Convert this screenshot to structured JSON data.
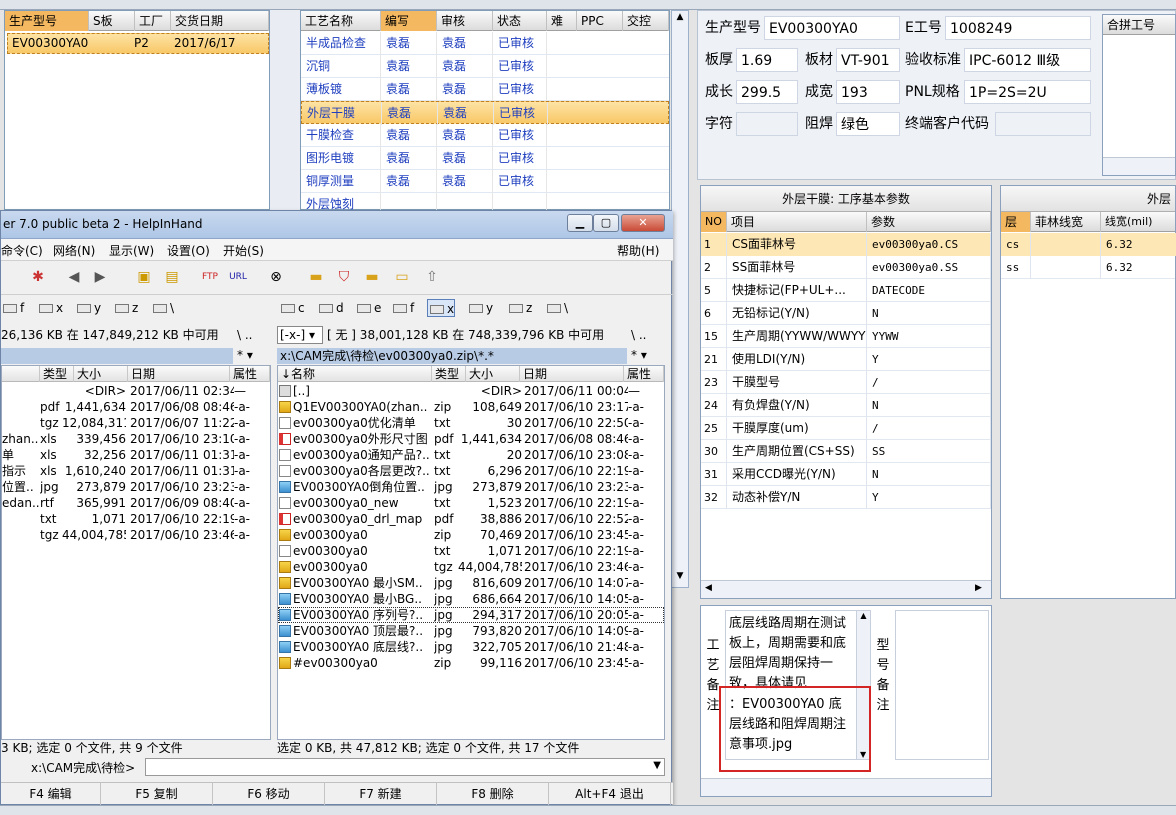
{
  "order_pane": {
    "headers": [
      "生产型号",
      "S板",
      "工厂",
      "交货日期"
    ],
    "rows": [
      {
        "model": "EV00300YA0",
        "s": "",
        "factory": "P2",
        "date": "2017/6/17"
      }
    ]
  },
  "process_pane": {
    "headers": [
      "工艺名称",
      "编写",
      "审核",
      "状态",
      "难",
      "PPC",
      "交控"
    ],
    "rows": [
      {
        "name": "半成品检查",
        "writer": "袁磊",
        "reviewer": "袁磊",
        "status": "已审核"
      },
      {
        "name": "沉铜",
        "writer": "袁磊",
        "reviewer": "袁磊",
        "status": "已审核"
      },
      {
        "name": "薄板镀",
        "writer": "袁磊",
        "reviewer": "袁磊",
        "status": "已审核"
      },
      {
        "name": "外层干膜",
        "writer": "袁磊",
        "reviewer": "袁磊",
        "status": "已审核"
      },
      {
        "name": "干膜检查",
        "writer": "袁磊",
        "reviewer": "袁磊",
        "status": "已审核"
      },
      {
        "name": "图形电镀",
        "writer": "袁磊",
        "reviewer": "袁磊",
        "status": "已审核"
      },
      {
        "name": "铜厚测量",
        "writer": "袁磊",
        "reviewer": "袁磊",
        "status": "已审核"
      },
      {
        "name": "外层蚀刻",
        "writer": "",
        "reviewer": "",
        "status": ""
      }
    ]
  },
  "info": {
    "model_label": "生产型号",
    "model_value": "EV00300YA0",
    "eno_label": "E工号",
    "eno_value": "1008249",
    "thick_label": "板厚",
    "thick_value": "1.69",
    "mat_label": "板材",
    "mat_value": "VT-901",
    "std_label": "验收标准",
    "std_value": "IPC-6012 Ⅲ级",
    "len_label": "成长",
    "len_value": "299.5",
    "wid_label": "成宽",
    "wid_value": "193",
    "pnl_label": "PNL规格",
    "pnl_value": "1P=2S=2U",
    "char_label": "字符",
    "char_value": "",
    "mask_label": "阻焊",
    "mask_value": "绿色",
    "cust_label": "终端客户代码",
    "cust_value": "",
    "pin_label": "合拼工号"
  },
  "params": {
    "title": "外层干膜: 工序基本参数",
    "headers": [
      "NO",
      "项目",
      "参数"
    ],
    "rows": [
      {
        "no": "1",
        "item": "CS面菲林号",
        "value": "ev00300ya0.CS"
      },
      {
        "no": "2",
        "item": "SS面菲林号",
        "value": "ev00300ya0.SS"
      },
      {
        "no": "5",
        "item": "快捷标记(FP+UL+...",
        "value": "DATECODE"
      },
      {
        "no": "6",
        "item": "无铅标记(Y/N)",
        "value": "N"
      },
      {
        "no": "15",
        "item": "生产周期(YYWW/WWYY)",
        "value": "YYWW"
      },
      {
        "no": "21",
        "item": "使用LDI(Y/N)",
        "value": "Y"
      },
      {
        "no": "23",
        "item": "干膜型号",
        "value": "/"
      },
      {
        "no": "24",
        "item": "有负焊盘(Y/N)",
        "value": "N"
      },
      {
        "no": "25",
        "item": "干膜厚度(um)",
        "value": "/"
      },
      {
        "no": "30",
        "item": "生产周期位置(CS+SS)",
        "value": "SS"
      },
      {
        "no": "31",
        "item": "采用CCD曝光(Y/N)",
        "value": "N"
      },
      {
        "no": "32",
        "item": "动态补偿Y/N",
        "value": "Y"
      }
    ]
  },
  "lines": {
    "title": "外层",
    "headers": [
      "层",
      "菲林线宽",
      "线宽(mil)"
    ],
    "rows": [
      {
        "layer": "cs",
        "film": "",
        "width": "6.32"
      },
      {
        "layer": "ss",
        "film": "",
        "width": "6.32"
      }
    ]
  },
  "notes": {
    "label_proc": [
      "工",
      "艺",
      "备",
      "注"
    ],
    "label_model": [
      "型",
      "号",
      "备",
      "注"
    ],
    "text_top": "底层线路周期在测试板上，周期需要和底层阻焊周期保持一致，具体请见",
    "text_bottom": "：EV00300YA0 底层线路和阻焊周期注意事项.jpg"
  },
  "fm": {
    "title": "er 7.0 public beta 2 - HelpInHand",
    "menu": [
      "命令(C)",
      "网络(N)",
      "显示(W)",
      "设置(O)",
      "开始(S)"
    ],
    "help": "帮助(H)",
    "left_drives": [
      "f",
      "x",
      "y",
      "z",
      "\\"
    ],
    "right_drives": [
      "c",
      "d",
      "e",
      "f",
      "x",
      "y",
      "z",
      "\\"
    ],
    "left_info": "26,136 KB 在 147,849,212 KB 中可用",
    "right_drive_combo": "[-x-]",
    "right_info": "[ 无 ]  38,001,128 KB 在 748,339,796 KB 中可用",
    "right_path": "x:\\CAM完成\\待检\\ev00300ya0.zip\\*.*",
    "filter": "*",
    "col_headers_left": [
      "类型",
      "大小",
      "日期",
      "属性"
    ],
    "col_headers_right": [
      "↓名称",
      "类型",
      "大小",
      "日期",
      "属性"
    ],
    "left_files": [
      {
        "name": "",
        "type": "",
        "size": "<DIR>",
        "date": "2017/06/11 02:34",
        "attr": "—"
      },
      {
        "name": "",
        "type": "pdf",
        "size": "1,441,634",
        "date": "2017/06/08 08:46",
        "attr": "-a-"
      },
      {
        "name": "",
        "type": "tgz",
        "size": "12,084,311",
        "date": "2017/06/07 11:22",
        "attr": "-a-"
      },
      {
        "name": "zhan..",
        "type": "xls",
        "size": "339,456",
        "date": "2017/06/10 23:10",
        "attr": "-a-"
      },
      {
        "name": "单",
        "type": "xls",
        "size": "32,256",
        "date": "2017/06/11 01:31",
        "attr": "-a-"
      },
      {
        "name": "指示",
        "type": "xls",
        "size": "1,610,240",
        "date": "2017/06/11 01:31",
        "attr": "-a-"
      },
      {
        "name": "位置..",
        "type": "jpg",
        "size": "273,879",
        "date": "2017/06/10 23:23",
        "attr": "-a-"
      },
      {
        "name": "edan..",
        "type": "rtf",
        "size": "365,991",
        "date": "2017/06/09 08:40",
        "attr": "-a-"
      },
      {
        "name": "",
        "type": "txt",
        "size": "1,071",
        "date": "2017/06/10 22:19",
        "attr": "-a-"
      },
      {
        "name": "",
        "type": "tgz",
        "size": "44,004,785",
        "date": "2017/06/10 23:46",
        "attr": "-a-"
      }
    ],
    "right_files": [
      {
        "icon": "up",
        "name": "[..]",
        "type": "",
        "size": "<DIR>",
        "date": "2017/06/11 00:04",
        "attr": "—"
      },
      {
        "icon": "zip",
        "name": "Q1EV00300YA0(zhan..",
        "type": "zip",
        "size": "108,649",
        "date": "2017/06/10 23:17",
        "attr": "-a-"
      },
      {
        "icon": "txt",
        "name": "ev00300ya0优化清单",
        "type": "txt",
        "size": "30",
        "date": "2017/06/10 22:50",
        "attr": "-a-"
      },
      {
        "icon": "pdf",
        "name": "ev00300ya0外形尺寸图",
        "type": "pdf",
        "size": "1,441,634",
        "date": "2017/06/08 08:46",
        "attr": "-a-"
      },
      {
        "icon": "txt",
        "name": "ev00300ya0通知产品?..",
        "type": "txt",
        "size": "20",
        "date": "2017/06/10 23:08",
        "attr": "-a-"
      },
      {
        "icon": "txt",
        "name": "ev00300ya0各层更改?..",
        "type": "txt",
        "size": "6,296",
        "date": "2017/06/10 22:19",
        "attr": "-a-"
      },
      {
        "icon": "jpg",
        "name": "EV00300YA0倒角位置..",
        "type": "jpg",
        "size": "273,879",
        "date": "2017/06/10 23:23",
        "attr": "-a-"
      },
      {
        "icon": "txt",
        "name": "ev00300ya0_new",
        "type": "txt",
        "size": "1,523",
        "date": "2017/06/10 22:19",
        "attr": "-a-"
      },
      {
        "icon": "pdf",
        "name": "ev00300ya0_drl_map",
        "type": "pdf",
        "size": "38,886",
        "date": "2017/06/10 22:52",
        "attr": "-a-"
      },
      {
        "icon": "zip",
        "name": "ev00300ya0",
        "type": "zip",
        "size": "70,469",
        "date": "2017/06/10 23:45",
        "attr": "-a-"
      },
      {
        "icon": "txt",
        "name": "ev00300ya0",
        "type": "txt",
        "size": "1,071",
        "date": "2017/06/10 22:19",
        "attr": "-a-"
      },
      {
        "icon": "zip",
        "name": "ev00300ya0",
        "type": "tgz",
        "size": "44,004,785",
        "date": "2017/06/10 23:46",
        "attr": "-a-"
      },
      {
        "icon": "zip",
        "name": "EV00300YA0 最小SM..",
        "type": "jpg",
        "size": "816,609",
        "date": "2017/06/10 14:07",
        "attr": "-a-"
      },
      {
        "icon": "jpg",
        "name": "EV00300YA0 最小BG..",
        "type": "jpg",
        "size": "686,664",
        "date": "2017/06/10 14:05",
        "attr": "-a-"
      },
      {
        "icon": "jpg",
        "name": "EV00300YA0 序列号?..",
        "type": "jpg",
        "size": "294,317",
        "date": "2017/06/10 20:05",
        "attr": "-a-"
      },
      {
        "icon": "jpg",
        "name": "EV00300YA0 顶层最?..",
        "type": "jpg",
        "size": "793,820",
        "date": "2017/06/10 14:09",
        "attr": "-a-"
      },
      {
        "icon": "jpg",
        "name": "EV00300YA0 底层线?..",
        "type": "jpg",
        "size": "322,705",
        "date": "2017/06/10 21:48",
        "attr": "-a-"
      },
      {
        "icon": "zip",
        "name": "#ev00300ya0",
        "type": "zip",
        "size": "99,116",
        "date": "2017/06/10 23:45",
        "attr": "-a-"
      }
    ],
    "left_status": "3 KB; 选定 0 个文件, 共 9 个文件",
    "right_status": "选定 0 KB, 共 47,812 KB; 选定 0 个文件, 共 17 个文件",
    "cmd_prompt": "x:\\CAM完成\\待检>",
    "fkeys": [
      "F4 编辑",
      "F5 复制",
      "F6 移动",
      "F7 新建",
      "F8 删除",
      "Alt+F4 退出"
    ]
  }
}
